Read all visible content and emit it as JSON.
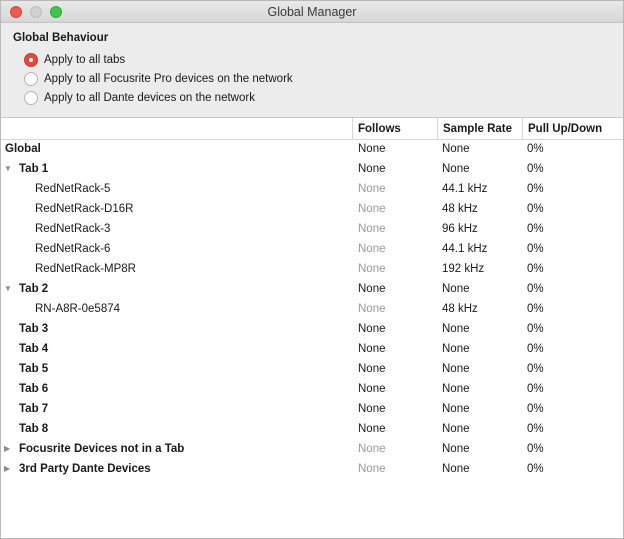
{
  "window": {
    "title": "Global Manager"
  },
  "behaviour": {
    "title": "Global Behaviour",
    "options": [
      {
        "label": "Apply to all tabs",
        "checked": true
      },
      {
        "label": "Apply to all Focusrite Pro devices on the network",
        "checked": false
      },
      {
        "label": "Apply to all Dante devices on the network",
        "checked": false
      }
    ]
  },
  "table": {
    "columns": {
      "name": "",
      "follows": "Follows",
      "sample_rate": "Sample Rate",
      "pull": "Pull Up/Down"
    },
    "rows": [
      {
        "name": "Global",
        "follows": "None",
        "sample_rate": "None",
        "pull": "0%"
      },
      {
        "name": "Tab 1",
        "follows": "None",
        "sample_rate": "None",
        "pull": "0%"
      },
      {
        "name": "RedNetRack-5",
        "follows": "None",
        "sample_rate": "44.1 kHz",
        "pull": "0%"
      },
      {
        "name": "RedNetRack-D16R",
        "follows": "None",
        "sample_rate": "48 kHz",
        "pull": "0%"
      },
      {
        "name": "RedNetRack-3",
        "follows": "None",
        "sample_rate": "96 kHz",
        "pull": "0%"
      },
      {
        "name": "RedNetRack-6",
        "follows": "None",
        "sample_rate": "44.1 kHz",
        "pull": "0%"
      },
      {
        "name": "RedNetRack-MP8R",
        "follows": "None",
        "sample_rate": "192 kHz",
        "pull": "0%"
      },
      {
        "name": "Tab 2",
        "follows": "None",
        "sample_rate": "None",
        "pull": "0%"
      },
      {
        "name": "RN-A8R-0e5874",
        "follows": "None",
        "sample_rate": "48 kHz",
        "pull": "0%"
      },
      {
        "name": "Tab 3",
        "follows": "None",
        "sample_rate": "None",
        "pull": "0%"
      },
      {
        "name": "Tab 4",
        "follows": "None",
        "sample_rate": "None",
        "pull": "0%"
      },
      {
        "name": "Tab 5",
        "follows": "None",
        "sample_rate": "None",
        "pull": "0%"
      },
      {
        "name": "Tab 6",
        "follows": "None",
        "sample_rate": "None",
        "pull": "0%"
      },
      {
        "name": "Tab 7",
        "follows": "None",
        "sample_rate": "None",
        "pull": "0%"
      },
      {
        "name": "Tab 8",
        "follows": "None",
        "sample_rate": "None",
        "pull": "0%"
      },
      {
        "name": "Focusrite Devices not in a Tab",
        "follows": "None",
        "sample_rate": "None",
        "pull": "0%"
      },
      {
        "name": "3rd Party Dante Devices",
        "follows": "None",
        "sample_rate": "None",
        "pull": "0%"
      }
    ]
  }
}
